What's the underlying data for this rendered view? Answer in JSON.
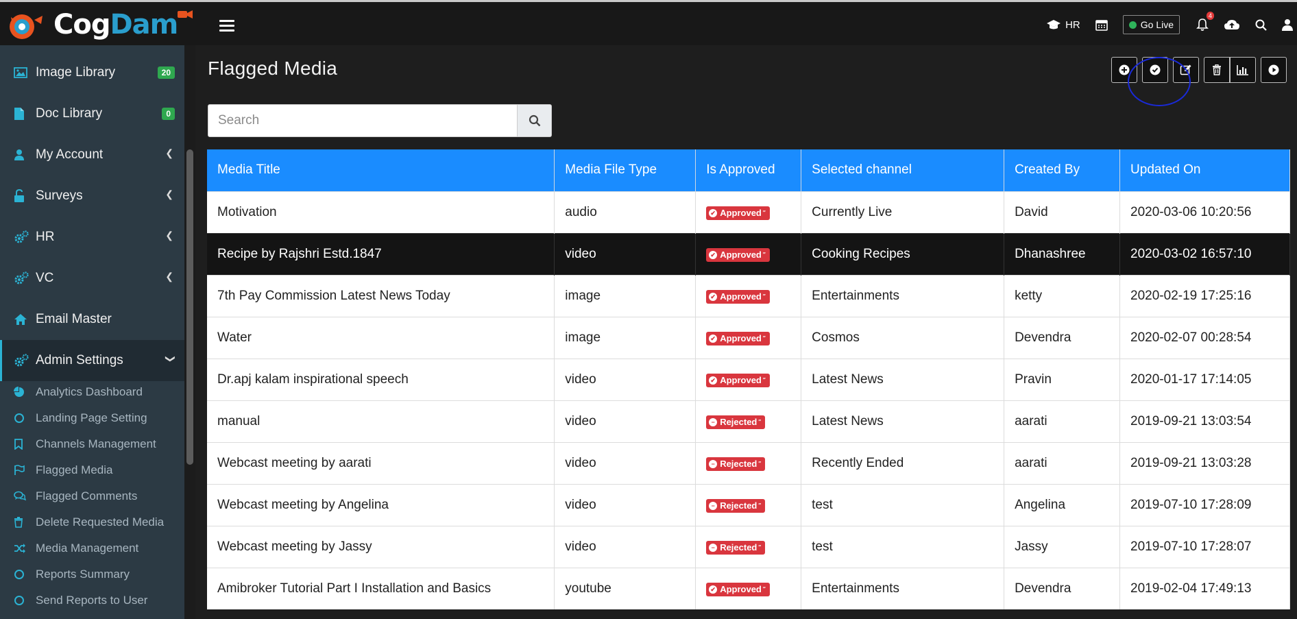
{
  "brand": {
    "part1": "Cog",
    "part2": "Dam"
  },
  "topbar": {
    "hr_label": "HR",
    "golive_label": "Go Live",
    "notification_count": "4"
  },
  "sidebar": {
    "items": [
      {
        "label": "Image Library",
        "badge": "20",
        "icon": "image-icon"
      },
      {
        "label": "Doc Library",
        "badge": "0",
        "icon": "file-icon"
      },
      {
        "label": "My Account",
        "icon": "user-icon"
      },
      {
        "label": "Surveys",
        "icon": "unlock-icon"
      },
      {
        "label": "HR",
        "icon": "cogs-icon"
      },
      {
        "label": "VC",
        "icon": "cogs-icon"
      },
      {
        "label": "Email Master",
        "icon": "home-icon"
      },
      {
        "label": "Admin Settings",
        "icon": "cogs-icon"
      }
    ],
    "subitems": [
      {
        "label": "Analytics Dashboard",
        "icon": "pie-chart-icon"
      },
      {
        "label": "Landing Page Setting",
        "icon": "circle-icon"
      },
      {
        "label": "Channels Management",
        "icon": "bookmark-icon"
      },
      {
        "label": "Flagged Media",
        "icon": "flag-icon"
      },
      {
        "label": "Flagged Comments",
        "icon": "comments-icon"
      },
      {
        "label": "Delete Requested Media",
        "icon": "trash-icon"
      },
      {
        "label": "Media Management",
        "icon": "shuffle-icon"
      },
      {
        "label": "Reports Summary",
        "icon": "circle-icon"
      },
      {
        "label": "Send Reports to User",
        "icon": "circle-icon"
      }
    ]
  },
  "page": {
    "title": "Flagged Media"
  },
  "search": {
    "placeholder": "Search"
  },
  "table": {
    "columns": [
      "Media Title",
      "Media File Type",
      "Is Approved",
      "Selected channel",
      "Created By",
      "Updated On"
    ],
    "rows": [
      {
        "title": "Motivation",
        "type": "audio",
        "status": "Approved",
        "channel": "Currently Live",
        "created_by": "David",
        "updated_on": "2020-03-06 10:20:56"
      },
      {
        "title": "Recipe by Rajshri Estd.1847",
        "type": "video",
        "status": "Approved",
        "channel": "Cooking Recipes",
        "created_by": "Dhanashree",
        "updated_on": "2020-03-02 16:57:10"
      },
      {
        "title": "7th Pay Commission Latest News Today",
        "type": "image",
        "status": "Approved",
        "channel": "Entertainments",
        "created_by": "ketty",
        "updated_on": "2020-02-19 17:25:16"
      },
      {
        "title": "Water",
        "type": "image",
        "status": "Approved",
        "channel": "Cosmos",
        "created_by": "Devendra",
        "updated_on": "2020-02-07 00:28:54"
      },
      {
        "title": "Dr.apj kalam inspirational speech",
        "type": "video",
        "status": "Approved",
        "channel": "Latest News",
        "created_by": "Pravin",
        "updated_on": "2020-01-17 17:14:05"
      },
      {
        "title": "manual",
        "type": "video",
        "status": "Rejected",
        "channel": "Latest News",
        "created_by": "aarati",
        "updated_on": "2019-09-21 13:03:54"
      },
      {
        "title": "Webcast meeting by aarati",
        "type": "video",
        "status": "Rejected",
        "channel": "Recently Ended",
        "created_by": "aarati",
        "updated_on": "2019-09-21 13:03:28"
      },
      {
        "title": "Webcast meeting by Angelina",
        "type": "video",
        "status": "Rejected",
        "channel": "test",
        "created_by": "Angelina",
        "updated_on": "2019-07-10 17:28:09"
      },
      {
        "title": "Webcast meeting by Jassy",
        "type": "video",
        "status": "Rejected",
        "channel": "test",
        "created_by": "Jassy",
        "updated_on": "2019-07-10 17:28:07"
      },
      {
        "title": "Amibroker Tutorial Part I Installation and Basics",
        "type": "youtube",
        "status": "Approved",
        "channel": "Entertainments",
        "created_by": "Devendra",
        "updated_on": "2019-02-04 17:49:13"
      }
    ]
  },
  "colors": {
    "accent": "#1a8cff",
    "sidebar_bg": "#2c3a44",
    "status_red": "#d9363e",
    "icon_cyan": "#2bb3d4"
  }
}
